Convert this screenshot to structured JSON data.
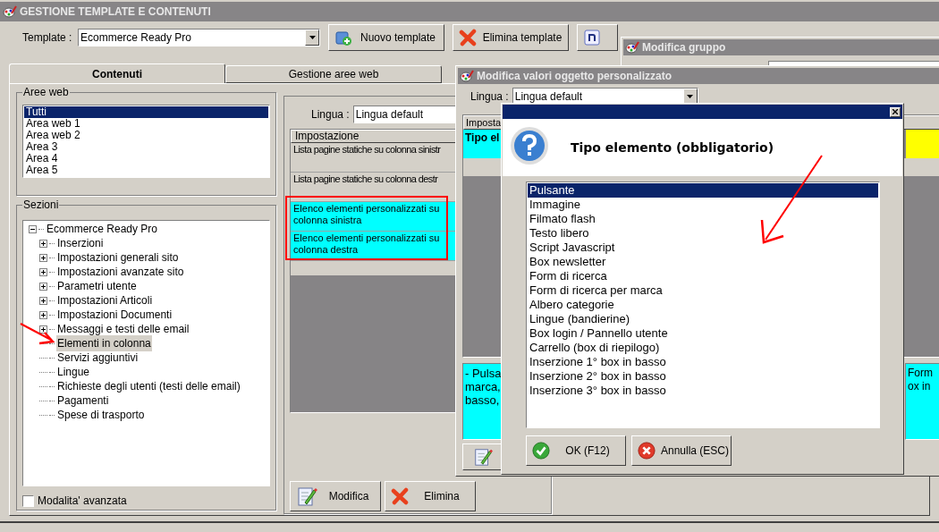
{
  "window": {
    "title": "GESTIONE TEMPLATE E CONTENUTI"
  },
  "template": {
    "label": "Template :",
    "value": "Ecommerce Ready Pro"
  },
  "toolbar": [
    {
      "label": "Nuovo template",
      "kind": "new"
    },
    {
      "label": "Elimina template",
      "kind": "delete"
    },
    {
      "kind": "size"
    }
  ],
  "tabs": [
    {
      "label": "Contenuti",
      "selected": true
    },
    {
      "label": "Gestione aree web",
      "selected": false
    }
  ],
  "aree_web": {
    "title": "Aree web",
    "items": [
      {
        "label": "Tutti",
        "selected": true
      },
      {
        "label": "Area web 1",
        "selected": false
      },
      {
        "label": "Area web 2",
        "selected": false
      },
      {
        "label": "Area 3",
        "selected": false
      },
      {
        "label": "Area 4",
        "selected": false
      },
      {
        "label": "Area 5",
        "selected": false
      }
    ]
  },
  "sezioni": {
    "title": "Sezioni",
    "tree": {
      "label": "Ecommerce Ready Pro",
      "expanded": true,
      "selected": false,
      "children": [
        {
          "label": "Inserzioni",
          "kind": "node",
          "expanded": false,
          "selected": false
        },
        {
          "label": "Impostazioni generali sito",
          "kind": "node",
          "expanded": false,
          "selected": false
        },
        {
          "label": "Impostazioni avanzate sito",
          "kind": "node",
          "expanded": false,
          "selected": false
        },
        {
          "label": "Parametri utente",
          "kind": "node",
          "expanded": false,
          "selected": false
        },
        {
          "label": "Impostazioni Articoli",
          "kind": "node",
          "expanded": false,
          "selected": false
        },
        {
          "label": "Impostazioni Documenti",
          "kind": "node",
          "expanded": false,
          "selected": false
        },
        {
          "label": "Messaggi e testi delle email",
          "kind": "node",
          "expanded": false,
          "selected": false
        },
        {
          "label": "Elementi in colonna",
          "kind": "leaf",
          "selected": true
        },
        {
          "label": "Servizi aggiuntivi",
          "kind": "leaf",
          "selected": false
        },
        {
          "label": "Lingue",
          "kind": "leaf",
          "selected": false
        },
        {
          "label": "Richieste degli utenti (testi delle email)",
          "kind": "leaf",
          "selected": false
        },
        {
          "label": "Pagamenti",
          "kind": "leaf",
          "selected": false
        },
        {
          "label": "Spese di trasporto",
          "kind": "leaf",
          "selected": false
        }
      ]
    }
  },
  "advanced_mode": {
    "label": "Modalita' avanzata",
    "checked": false
  },
  "content": {
    "lingua_label": "Lingua :",
    "lingua_value": "Lingua default",
    "column": "Impostazione",
    "rows": [
      {
        "text": "Lista pagine statiche su colonna sinistr",
        "selected": false
      },
      {
        "text": "Lista pagine statiche su colonna destr",
        "selected": false
      },
      {
        "text": "Elenco elementi personalizzati su colonna sinistra",
        "selected": true
      },
      {
        "text": "Elenco elementi personalizzati su colonna destra",
        "selected": true
      }
    ],
    "buttons": [
      {
        "label": "Modifica",
        "kind": "edit"
      },
      {
        "label": "Elimina",
        "kind": "delete"
      }
    ]
  },
  "group_window": {
    "title": "Modifica gruppo"
  },
  "values_window": {
    "title": "Modifica valori oggetto personalizzato",
    "lingua_label": "Lingua :",
    "lingua_value": "Lingua default",
    "column": "Imposta",
    "cell": "Tipo el",
    "description": [
      "- Pulsa",
      "marca,",
      "basso,"
    ],
    "right_description": [
      "Form",
      "ox in"
    ]
  },
  "dialog": {
    "title": "Tipo elemento (obbligatorio)",
    "options": [
      {
        "label": "Pulsante",
        "selected": true
      },
      {
        "label": "Immagine",
        "selected": false
      },
      {
        "label": "Filmato flash",
        "selected": false
      },
      {
        "label": "Testo libero",
        "selected": false
      },
      {
        "label": "Script Javascript",
        "selected": false
      },
      {
        "label": "Box newsletter",
        "selected": false
      },
      {
        "label": "Form di ricerca",
        "selected": false
      },
      {
        "label": "Form di ricerca per marca",
        "selected": false
      },
      {
        "label": "Albero categorie",
        "selected": false
      },
      {
        "label": "Lingue (bandierine)",
        "selected": false
      },
      {
        "label": "Box login / Pannello utente",
        "selected": false
      },
      {
        "label": "Carrello (box di riepilogo)",
        "selected": false
      },
      {
        "label": "Inserzione 1° box in basso",
        "selected": false
      },
      {
        "label": "Inserzione 2° box in basso",
        "selected": false
      },
      {
        "label": "Inserzione 3° box in basso",
        "selected": false
      }
    ],
    "buttons": [
      {
        "label": "OK (F12)",
        "kind": "ok"
      },
      {
        "label": "Annulla (ESC)",
        "kind": "cancel"
      }
    ]
  }
}
